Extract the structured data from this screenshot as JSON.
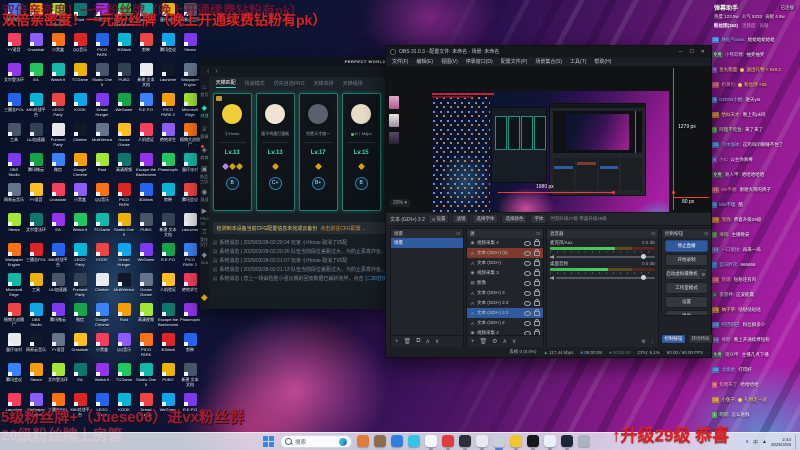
{
  "overlays": {
    "top_line": "双倍亲密度！一元粉丝牌（晚上开通续费钻粉有pk）",
    "bottom_line1": "5级粉丝牌+（Juese06）进vx粉丝群",
    "bottom_line2": "20级粉丝牌上房管",
    "bottom_right": "↑升级29级 恭喜",
    "red": "#d42626",
    "dark_red": "#a11f35"
  },
  "desktop": {
    "cols": 9,
    "rows": 14,
    "icon_labels": [
      "腾讯微云",
      "微信",
      "Google Chrome",
      "Rust",
      "高清视频",
      "Escape the Backrooms",
      "Phasmophobia",
      "蛋仔派对",
      "网易云音乐",
      "YY语音",
      "Crosshair",
      "小黑盒",
      "QQ音乐",
      "PICO PARK",
      "3DMark",
      "剪映",
      "腾讯会议",
      "Steam",
      "艾尔登法环",
      "EA",
      "Watch It",
      "TCGame",
      "Studio One 5",
      "PUBG",
      "新建 文本文档",
      "Launcher",
      "Wallpaper Engine",
      "三國志POL",
      "KiKi对战平台",
      "LEGO Party",
      "KOOK",
      "Dread Hunger",
      "WeGame",
      "R.E.P.O",
      "PICO PARK 2",
      "Microsoft Edge",
      "工具",
      "UU加速器",
      "Pummel Party",
      "Climber",
      "MultiVersus",
      "Goose Goose Duck",
      "人机验证",
      "绝地求生",
      "植物大战僵尸",
      "OBS Studio"
    ],
    "palette": [
      "#3b82f6",
      "#22c55e",
      "#e8eaed",
      "#8b5cf6",
      "#ef4444",
      "#f59e0b",
      "#14b8a6",
      "#111827",
      "#f97316",
      "#0ea5e9",
      "#a3e635",
      "#eab308",
      "#64748b",
      "#dc2626",
      "#7c3aed",
      "#0f766e",
      "#475569",
      "#fbbf24",
      "#2563eb",
      "#16a34a",
      "#9333ea",
      "#334155",
      "#f43f5e",
      "#06b6d4"
    ]
  },
  "launcher": {
    "brand": "PERFECT WORLD",
    "nav_back": "‹",
    "nav_fwd": "›",
    "sidebar": [
      {
        "label": "首页",
        "icon": "⌂"
      },
      {
        "label": "对战",
        "icon": "◆",
        "active": true
      },
      {
        "label": "赛事",
        "icon": "♕"
      },
      {
        "label": "商城",
        "icon": "◈",
        "dot": true
      },
      {
        "label": "饰品工坊",
        "icon": "▣"
      },
      {
        "label": "观战",
        "icon": "◉"
      },
      {
        "label": "PRO TV",
        "icon": "▶"
      },
      {
        "label": "竞技大厅",
        "icon": "♖"
      },
      {
        "label": "2K8",
        "icon": "◆"
      }
    ],
    "tabs": [
      "天梯匹配",
      "快速模式",
      "优先自选PRO",
      "天梯单排",
      "天梯组排"
    ],
    "active_tab": 0,
    "cards": [
      {
        "name": "小Horse",
        "level": "Lv.13",
        "avatar": "#f2cf3a",
        "badge": "B",
        "ranks": [
          "#b08ae0",
          "#d4a017",
          "#d4a017"
        ],
        "crown": true
      },
      {
        "name": "蛋不鸡蛋打蛋糕",
        "level": "Lv.13",
        "avatar": "#efe3d2",
        "badge": "C+",
        "ranks": [
          "#d4a017"
        ]
      },
      {
        "name": "险胜天才扁一",
        "level": "Lv.17",
        "avatar": "#59616c",
        "badge": "B+",
        "ranks": [
          "#d4a017"
        ]
      },
      {
        "name": "M丨Major",
        "level": "Lv.15",
        "avatar": "#e9ddc8",
        "badge": "B",
        "ranks": [
          "#d4a017"
        ],
        "online": true
      }
    ],
    "notice": "检测到本设备当前CFG配置信息未完成云备份",
    "notice_link": "点击前往CFG配置→",
    "messages": [
      {
        "text": "系统消息 | 2025/03/28-02:20:24 玩家 小Horse 取消了匹配"
      },
      {
        "text": "系统消息 | 2025/03/28-02:20:26 队伍当前段位差距过大，为防止恶意炸鱼，将限制匹配"
      },
      {
        "text": "系统消息 | 2025/03/28-02:21:07 玩家 小Horse 取消了匹配"
      },
      {
        "text": "系统消息 | 2025/03/28-02:21:13 队伍当前段位差距过大，为防止恶意炸鱼，将限制匹配"
      },
      {
        "text": "系统消息 | 您上一场由险胜小强比赛的回放数据已解析完毕，点击",
        "link": "[二四替换]"
      }
    ]
  },
  "obs": {
    "title": "OBS 31.0.3 - 配置文件: 未命名 - 场景: 未命名",
    "window_buttons": [
      "─",
      "☐",
      "✕"
    ],
    "menu": [
      "文件(F)",
      "编辑(E)",
      "视图(V)",
      "停靠窗口(D)",
      "配置文件(P)",
      "场景集合(S)",
      "工具(T)",
      "帮助(H)"
    ],
    "preview": {
      "zoom_label": "20% ▾",
      "width_label": "1980 px",
      "height_label": "1279 px",
      "gap_label": "80 px"
    },
    "source_toolbar": {
      "source": "文本 (GDI+) 3 2",
      "buttons": [
        "设置",
        "滤镜",
        "选择字体",
        "选择颜色",
        "字体"
      ],
      "preview_text": "时刻升级27级 恭喜升级29级"
    },
    "scenes": {
      "header": "场景",
      "items": [
        "场景"
      ]
    },
    "sources": {
      "header": "源",
      "items": [
        {
          "label": "视频采集 4",
          "icon": "camera"
        },
        {
          "label": "文本 (GDI+) (2)",
          "icon": "text",
          "state": "alert"
        },
        {
          "label": "文本 (GDI+)",
          "icon": "text"
        },
        {
          "label": "视频采集 3",
          "icon": "camera"
        },
        {
          "label": "图像",
          "icon": "image"
        },
        {
          "label": "文本 (GDI+) 3",
          "icon": "text"
        },
        {
          "label": "文本 (GDI+) 3 3",
          "icon": "text"
        },
        {
          "label": "文本 (GDI+) 3 2",
          "icon": "text",
          "state": "selected"
        },
        {
          "label": "文本 (GDI+) 2",
          "icon": "text"
        },
        {
          "label": "视频采集 2",
          "icon": "camera"
        }
      ]
    },
    "mixer": {
      "header": "混音器",
      "channels": [
        {
          "name": "麦克风/Aux",
          "db": "0.0 dB",
          "level": 62
        },
        {
          "name": "桌面音频",
          "db": "0.0 dB",
          "level": 55
        }
      ]
    },
    "controls": {
      "header": "控制按钮",
      "buttons": [
        {
          "label": "停止直播",
          "primary": true
        },
        {
          "label": "开始录制"
        },
        {
          "label": "启动虚拟摄像机",
          "gear": true
        },
        {
          "label": "工作室模式"
        },
        {
          "label": "设置"
        },
        {
          "label": "退出"
        }
      ]
    },
    "dock_chips": [
      {
        "label": "控制按钮",
        "active": true
      },
      {
        "label": "转场特效"
      }
    ],
    "status": {
      "dropped": "丢帧 0 (0.0%)",
      "bitrate": "117.44 kbps",
      "stream_time": "06:00:08",
      "rec_time": "00:00:00",
      "cpu": "CPU: 6.1%",
      "fps": "60.00 / 60.00 FPS"
    }
  },
  "chat": {
    "title": "弹幕助手",
    "status": "已连接",
    "stats": [
      "热度 123.5w",
      "人气 5233",
      "贡献 4.8w"
    ],
    "tabs": [
      "粉丝团(162)",
      "活跃度",
      "贡献"
    ],
    "messages": [
      {
        "badge": "21",
        "bc": "#3e8fe0",
        "name": "陆仙气ooxx",
        "nc": "#86c7ff",
        "text": "蛤蛤蛤蛤蛤蛤"
      },
      {
        "badge": "免费",
        "bc": "#565d66",
        "name": "小熊软糖",
        "nc": "#d8c2ff",
        "text": "抽奖抽奖"
      },
      {
        "badge": "9",
        "bc": "#8a5fd0",
        "name": "鱼丸粗面",
        "nc": "#ffd27f",
        "text": "送出礼物 × 648.2",
        "gold": true
      },
      {
        "badge": "12",
        "bc": "#e0607a",
        "name": "奶黄包",
        "nc": "#ff9ec2",
        "text": "粉丝牌 ×55",
        "gold": true
      },
      {
        "badge": "6",
        "bc": "#4a90e2",
        "name": "GOGO小姐",
        "nc": "#9fd8ff",
        "text": "进天yst"
      },
      {
        "badge": "17",
        "bc": "#d08a2e",
        "name": "恰似天才",
        "nc": "#ffe08a",
        "text": "晚上有pk吗"
      },
      {
        "badge": "3",
        "bc": "#5aa85a",
        "name": "阿狸不吃鱼",
        "nc": "#b8f0a8",
        "text": "来了来了"
      },
      {
        "badge": "21",
        "bc": "#3e8fe0",
        "name": "汽水加冰",
        "nc": "#86c7ff",
        "text": "这鸡叫闭眼睡不住了"
      },
      {
        "badge": "8",
        "bc": "#8a5fd0",
        "name": "小C",
        "nc": "#e0b3ff",
        "text": "公主你真棒"
      },
      {
        "badge": "免费",
        "bc": "#565d66",
        "name": "路人甲",
        "nc": "#cfd6dd",
        "text": "哈哈哈哈哈"
      },
      {
        "badge": "11",
        "bc": "#e0607a",
        "name": "Ms不谢",
        "nc": "#ff9ec2",
        "text": "谢谢大哥的牌子"
      },
      {
        "badge": "5",
        "bc": "#4a90e2",
        "name": "kbs不理",
        "nc": "#9fd8ff",
        "text": "酷"
      },
      {
        "badge": "19",
        "bc": "#d08a2e",
        "name": "泡泡",
        "nc": "#ffe08a",
        "text": "恭喜升级29级"
      },
      {
        "badge": "2",
        "bc": "#5aa85a",
        "name": "清风",
        "nc": "#b8f0a8",
        "text": "主播晚安"
      },
      {
        "badge": "14",
        "bc": "#8a5fd0",
        "name": "一口蛋挞",
        "nc": "#e0b3ff",
        "text": "再来一局"
      },
      {
        "badge": "7",
        "bc": "#3e8fe0",
        "name": "蓝白胖次",
        "nc": "#86c7ff",
        "text": "666666"
      },
      {
        "badge": "23",
        "bc": "#e0607a",
        "name": "糖霜",
        "nc": "#ff9ec2",
        "text": "钻粉还有吗"
      },
      {
        "badge": "4",
        "bc": "#565d66",
        "name": "夜游神",
        "nc": "#cfd6dd",
        "text": "这波能赢"
      },
      {
        "badge": "16",
        "bc": "#d08a2e",
        "name": "柚子茶",
        "nc": "#ffe08a",
        "text": "哒哒哒哒哒"
      },
      {
        "badge": "10",
        "bc": "#4a90e2",
        "name": "阿巴阿巴",
        "nc": "#9fd8ff",
        "text": "粉丝群多少"
      },
      {
        "badge": "13",
        "bc": "#8a5fd0",
        "name": "慕斯",
        "nc": "#e0b3ff",
        "text": "晚上开通续费钻粉"
      },
      {
        "badge": "免费",
        "bc": "#565d66",
        "name": "观众甲",
        "nc": "#cfd6dd",
        "text": "主播几点下播"
      },
      {
        "badge": "20",
        "bc": "#3e8fe0",
        "name": "北极星",
        "nc": "#86c7ff",
        "text": "打得好"
      },
      {
        "badge": "9",
        "bc": "#e0607a",
        "name": "焦糖布丁",
        "nc": "#ff9ec2",
        "text": "哈哈哈哈"
      },
      {
        "badge": "15",
        "bc": "#d08a2e",
        "name": "小鱼干",
        "nc": "#ffe08a",
        "text": "礼物走一波",
        "gold": true
      },
      {
        "badge": "1",
        "bc": "#5aa85a",
        "name": "萌新",
        "nc": "#b8f0a8",
        "text": "怎么进群"
      }
    ]
  },
  "taskbar": {
    "search_placeholder": "搜索",
    "clock_time": "2:44",
    "clock_date": "2025/3/28",
    "tray_icons": [
      "∧",
      "中",
      "▲"
    ],
    "apps": [
      {
        "name": "contacts",
        "color": "#e07b39"
      },
      {
        "name": "files",
        "color": "#8a6d4b"
      },
      {
        "name": "edge",
        "color": "#2f7fe0"
      },
      {
        "name": "cloud",
        "color": "#35c3e8"
      },
      {
        "name": "qq",
        "color": "#f5f7fa",
        "running": true
      },
      {
        "name": "netease-music",
        "color": "#e03a3a",
        "running": true
      },
      {
        "name": "dark-app",
        "color": "#2b3038",
        "running": true
      },
      {
        "name": "chrome",
        "color": "#e8eaed",
        "running": true
      },
      {
        "name": "cs2",
        "color": "#c8cedb",
        "active": true
      },
      {
        "name": "kiwi",
        "color": "#f0c530",
        "running": true
      },
      {
        "name": "obs",
        "color": "#15171a",
        "running": true
      },
      {
        "name": "bilibili",
        "color": "#e8f0f8",
        "running": true
      },
      {
        "name": "steam",
        "color": "#1b2838",
        "running": true
      },
      {
        "name": "network-tool",
        "color": "#aab4c0"
      }
    ]
  }
}
